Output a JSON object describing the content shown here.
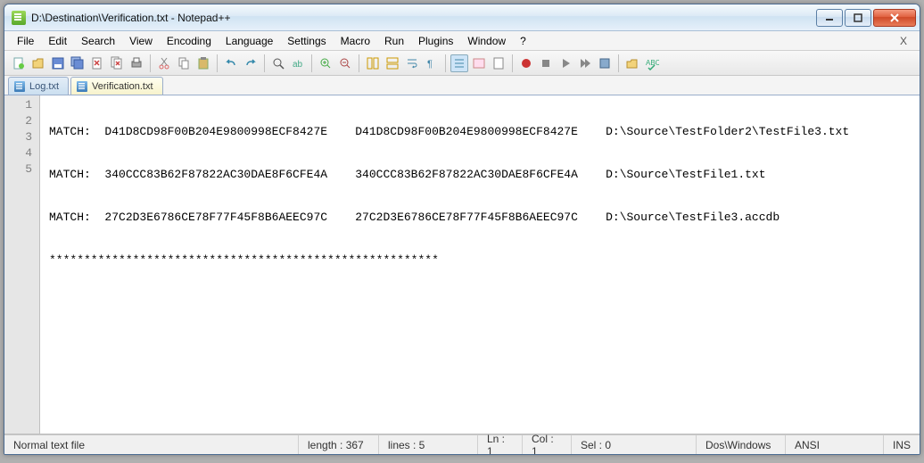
{
  "window": {
    "title": "D:\\Destination\\Verification.txt - Notepad++"
  },
  "menu": {
    "file": "File",
    "edit": "Edit",
    "search": "Search",
    "view": "View",
    "encoding": "Encoding",
    "language": "Language",
    "settings": "Settings",
    "macro": "Macro",
    "run": "Run",
    "plugins": "Plugins",
    "window": "Window",
    "help": "?"
  },
  "tabs": [
    {
      "label": "Log.txt"
    },
    {
      "label": "Verification.txt"
    }
  ],
  "lines": [
    "MATCH:  D41D8CD98F00B204E9800998ECF8427E    D41D8CD98F00B204E9800998ECF8427E    D:\\Source\\TestFolder2\\TestFile3.txt",
    "MATCH:  340CCC83B62F87822AC30DAE8F6CFE4A    340CCC83B62F87822AC30DAE8F6CFE4A    D:\\Source\\TestFile1.txt",
    "MATCH:  27C2D3E6786CE78F77F45F8B6AEEC97C    27C2D3E6786CE78F77F45F8B6AEEC97C    D:\\Source\\TestFile3.accdb",
    "********************************************************",
    ""
  ],
  "status": {
    "filetype": "Normal text file",
    "length": "length : 367",
    "lines": "lines : 5",
    "ln": "Ln : 1",
    "col": "Col : 1",
    "sel": "Sel : 0",
    "eol": "Dos\\Windows",
    "encoding": "ANSI",
    "mode": "INS"
  },
  "linenums": [
    "1",
    "2",
    "3",
    "4",
    "5"
  ]
}
